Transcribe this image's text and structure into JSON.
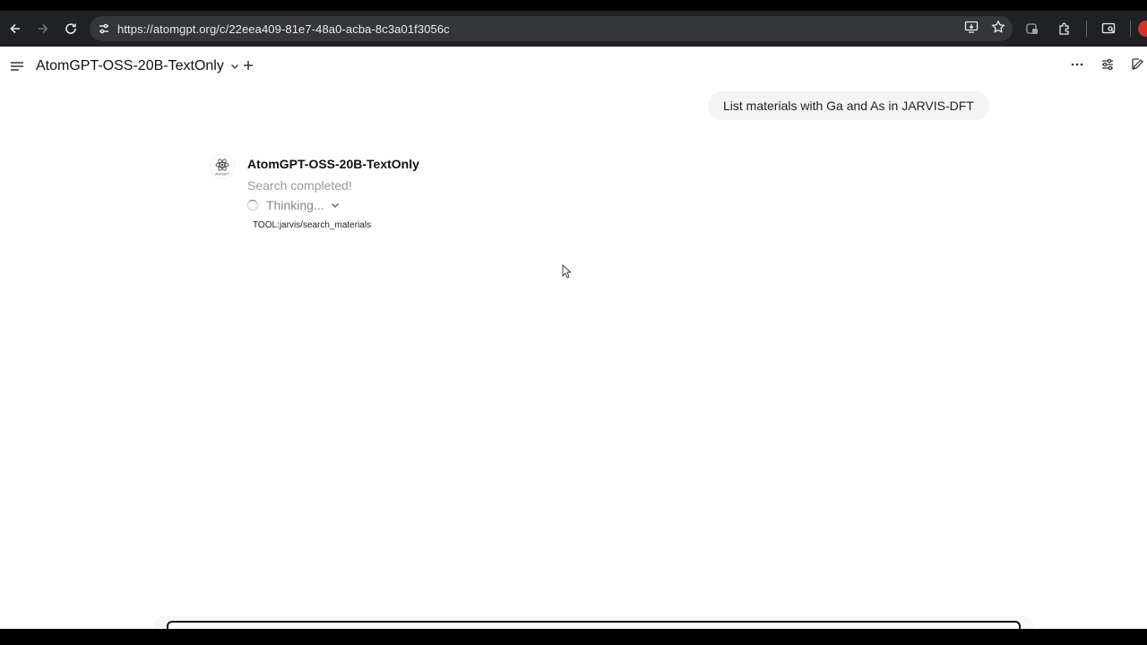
{
  "browser": {
    "url": "https://atomgpt.org/c/22eea409-81e7-48a0-acba-8c3a01f3056c",
    "icons": [
      "back-icon",
      "forward-icon",
      "reload-icon",
      "site-info-icon",
      "install-icon",
      "bookmark-star-icon",
      "extension-puzzle-icon",
      "sidepanel-icon"
    ]
  },
  "header": {
    "model_name": "AtomGPT-OSS-20B-TextOnly",
    "icons": [
      "menu-icon",
      "chevron-down-icon",
      "plus-icon",
      "more-icon",
      "settings-sliders-icon",
      "new-chat-icon"
    ]
  },
  "conversation": {
    "user_message": "List materials with Ga and As in JARVIS-DFT",
    "assistant": {
      "name": "AtomGPT-OSS-20B-TextOnly",
      "avatar_text": "AtomGPT",
      "status": "Search completed!",
      "thinking_label": "Thinking...",
      "tool_label": "TOOL:jarvis/search_materials"
    }
  }
}
